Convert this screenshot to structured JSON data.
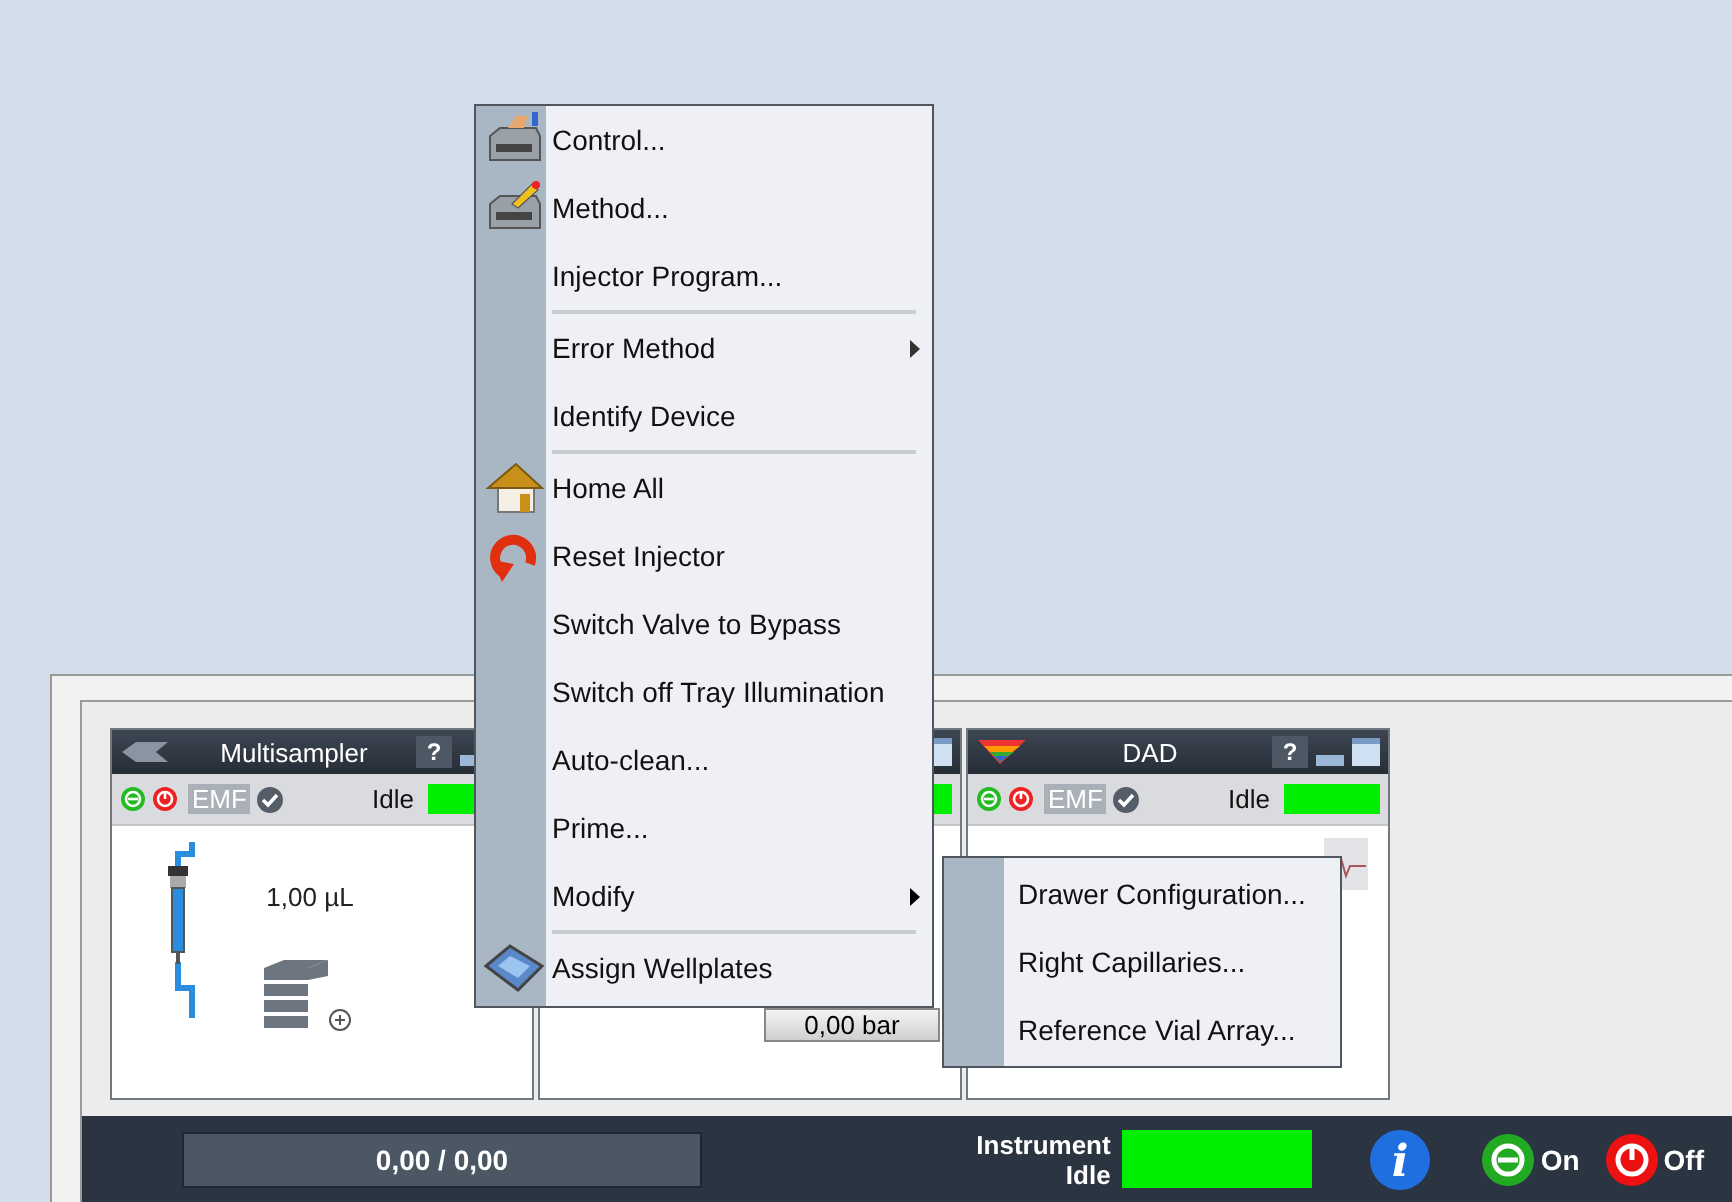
{
  "modules": [
    {
      "kind": "sampler",
      "title": "Multisampler",
      "help": "?",
      "emf": "EMF",
      "status": "Idle",
      "volume": "1,00 µL"
    },
    {
      "kind": "pump",
      "pressure": "0,00 bar"
    },
    {
      "kind": "detector",
      "title": "DAD",
      "help": "?",
      "emf": "EMF",
      "status": "Idle"
    }
  ],
  "context_menu": {
    "groups": [
      [
        {
          "label": "Control...",
          "has_submenu": false
        },
        {
          "label": "Method...",
          "has_submenu": false
        },
        {
          "label": "Injector Program...",
          "has_submenu": false
        }
      ],
      [
        {
          "label": "Error Method",
          "has_submenu": true,
          "expanded": false
        },
        {
          "label": "Identify Device",
          "has_submenu": false
        }
      ],
      [
        {
          "label": "Home All",
          "has_submenu": false
        },
        {
          "label": "Reset Injector",
          "has_submenu": false
        },
        {
          "label": "Switch Valve to Bypass",
          "has_submenu": false
        },
        {
          "label": "Switch off Tray Illumination",
          "has_submenu": false
        },
        {
          "label": "Auto-clean...",
          "has_submenu": false
        },
        {
          "label": "Prime...",
          "has_submenu": false
        },
        {
          "label": "Modify",
          "has_submenu": true,
          "expanded": true,
          "submenu": [
            {
              "label": "Drawer Configuration..."
            },
            {
              "label": "Right Capillaries..."
            },
            {
              "label": "Reference Vial Array..."
            }
          ]
        }
      ],
      [
        {
          "label": "Assign Wellplates",
          "has_submenu": false
        }
      ]
    ]
  },
  "status_bar": {
    "counter": "0,00 / 0,00",
    "instrument_label": "Instrument",
    "instrument_status": "Idle",
    "info": "i",
    "on_label": "On",
    "off_label": "Off"
  }
}
